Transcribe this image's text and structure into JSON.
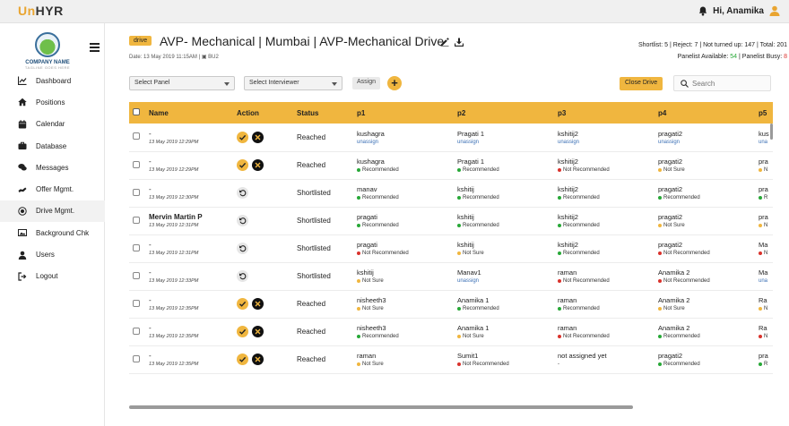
{
  "app": {
    "logo_prefix": "Un",
    "logo_suffix": "HYR",
    "user_greeting": "Hi, Anamika"
  },
  "sidebar": {
    "company_name": "COMPANY NAME",
    "company_tagline": "TAGLINE GOES HERE",
    "items": [
      {
        "label": "Dashboard",
        "icon": "chart-icon"
      },
      {
        "label": "Positions",
        "icon": "home-icon"
      },
      {
        "label": "Calendar",
        "icon": "calendar-icon"
      },
      {
        "label": "Database",
        "icon": "briefcase-icon"
      },
      {
        "label": "Messages",
        "icon": "chat-icon"
      },
      {
        "label": "Offer Mgmt.",
        "icon": "offer-icon"
      },
      {
        "label": "Drive Mgmt.",
        "icon": "drive-icon",
        "active": true
      },
      {
        "label": "Background Chk",
        "icon": "image-icon"
      },
      {
        "label": "Users",
        "icon": "user-icon"
      },
      {
        "label": "Logout",
        "icon": "logout-icon"
      }
    ]
  },
  "drive": {
    "badge": "drive",
    "title": "AVP- Mechanical | Mumbai | AVP-Mechanical Drive",
    "date": "Date: 13 May 2019 11:15AM | ",
    "unit": "BU2"
  },
  "stats": {
    "line1": "Shortlist: 5 | Reject: 7 | Not turned up: 147 | Total: 201",
    "panelist_available_label": "Panelist Available: ",
    "panelist_available": "54",
    "panelist_busy_label": " | Panelist Busy: ",
    "panelist_busy": "8"
  },
  "controls": {
    "select_panel": "Select Panel",
    "select_interviewer": "Select Interviewer",
    "assign": "Assign",
    "add": "+",
    "close_drive": "Close Drive",
    "search_placeholder": "Search"
  },
  "table": {
    "headers": [
      "Name",
      "Action",
      "Status",
      "p1",
      "p2",
      "p3",
      "p4",
      "p5"
    ],
    "rows": [
      {
        "name": "-",
        "bold": false,
        "date": "13 May 2019 12:29PM",
        "action": "decide",
        "status": "Reached",
        "p": [
          [
            "kushagra",
            "unassign",
            "link"
          ],
          [
            "Pragati 1",
            "unassign",
            "link"
          ],
          [
            "kshitij2",
            "unassign",
            "link"
          ],
          [
            "pragati2",
            "unassign",
            "link"
          ],
          [
            "kus",
            "una",
            "link"
          ]
        ]
      },
      {
        "name": "-",
        "bold": false,
        "date": "13 May 2019 12:29PM",
        "action": "decide",
        "status": "Reached",
        "p": [
          [
            "kushagra",
            "Recommended",
            "g"
          ],
          [
            "Pragati 1",
            "Recommended",
            "g"
          ],
          [
            "kshitij2",
            "Not Recommended",
            "r"
          ],
          [
            "pragati2",
            "Not Sure",
            "y"
          ],
          [
            "pra",
            "N",
            "y"
          ]
        ]
      },
      {
        "name": "-",
        "bold": false,
        "date": "13 May 2019 12:30PM",
        "action": "undo",
        "status": "Shortlisted",
        "p": [
          [
            "manav",
            "Recommended",
            "g"
          ],
          [
            "kshitij",
            "Recommended",
            "g"
          ],
          [
            "kshitij2",
            "Recommended",
            "g"
          ],
          [
            "pragati2",
            "Recommended",
            "g"
          ],
          [
            "pra",
            "R",
            "g"
          ]
        ]
      },
      {
        "name": "Mervin Martin P",
        "bold": true,
        "date": "13 May 2019 12:31PM",
        "action": "undo",
        "status": "Shortlisted",
        "p": [
          [
            "pragati",
            "Recommended",
            "g"
          ],
          [
            "kshitij",
            "Recommended",
            "g"
          ],
          [
            "kshitij2",
            "Recommended",
            "g"
          ],
          [
            "pragati2",
            "Not Sure",
            "y"
          ],
          [
            "pra",
            "N",
            "y"
          ]
        ]
      },
      {
        "name": "-",
        "bold": false,
        "date": "13 May 2019 12:31PM",
        "action": "undo",
        "status": "Shortlisted",
        "p": [
          [
            "pragati",
            "Not Recommended",
            "r"
          ],
          [
            "kshitij",
            "Not Sure",
            "y"
          ],
          [
            "kshitij2",
            "Recommended",
            "g"
          ],
          [
            "pragati2",
            "Not Recommended",
            "r"
          ],
          [
            "Ma",
            "N",
            "r"
          ]
        ]
      },
      {
        "name": "-",
        "bold": false,
        "date": "13 May 2019 12:33PM",
        "action": "undo",
        "status": "Shortlisted",
        "p": [
          [
            "kshitij",
            "Not Sure",
            "y"
          ],
          [
            "Manav1",
            "unassign",
            "link"
          ],
          [
            "raman",
            "Not Recommended",
            "r"
          ],
          [
            "Anamika 2",
            "Not Recommended",
            "r"
          ],
          [
            "Ma",
            "una",
            "link"
          ]
        ]
      },
      {
        "name": "-",
        "bold": false,
        "date": "13 May 2019 12:35PM",
        "action": "decide",
        "status": "Reached",
        "p": [
          [
            "nisheeth3",
            "Not Sure",
            "y"
          ],
          [
            "Anamika 1",
            "Recommended",
            "g"
          ],
          [
            "raman",
            "Recommended",
            "g"
          ],
          [
            "Anamika 2",
            "Not Sure",
            "y"
          ],
          [
            "Ra",
            "N",
            "y"
          ]
        ]
      },
      {
        "name": "-",
        "bold": false,
        "date": "13 May 2019 12:35PM",
        "action": "decide",
        "status": "Reached",
        "p": [
          [
            "nisheeth3",
            "Recommended",
            "g"
          ],
          [
            "Anamika 1",
            "Not Sure",
            "y"
          ],
          [
            "raman",
            "Not Recommended",
            "r"
          ],
          [
            "Anamika 2",
            "Recommended",
            "g"
          ],
          [
            "Ra",
            "N",
            "r"
          ]
        ]
      },
      {
        "name": "-",
        "bold": false,
        "date": "13 May 2019 12:35PM",
        "action": "decide",
        "status": "Reached",
        "p": [
          [
            "raman",
            "Not Sure",
            "y"
          ],
          [
            "Sumit1",
            "Not Recommended",
            "r"
          ],
          [
            "not assigned yet",
            "-",
            "none"
          ],
          [
            "pragati2",
            "Recommended",
            "g"
          ],
          [
            "pra",
            "R",
            "g"
          ]
        ]
      }
    ]
  },
  "colors": {
    "accent": "#f0b63f",
    "green": "#27a837",
    "red": "#d9322c",
    "link": "#3a6fb5"
  }
}
